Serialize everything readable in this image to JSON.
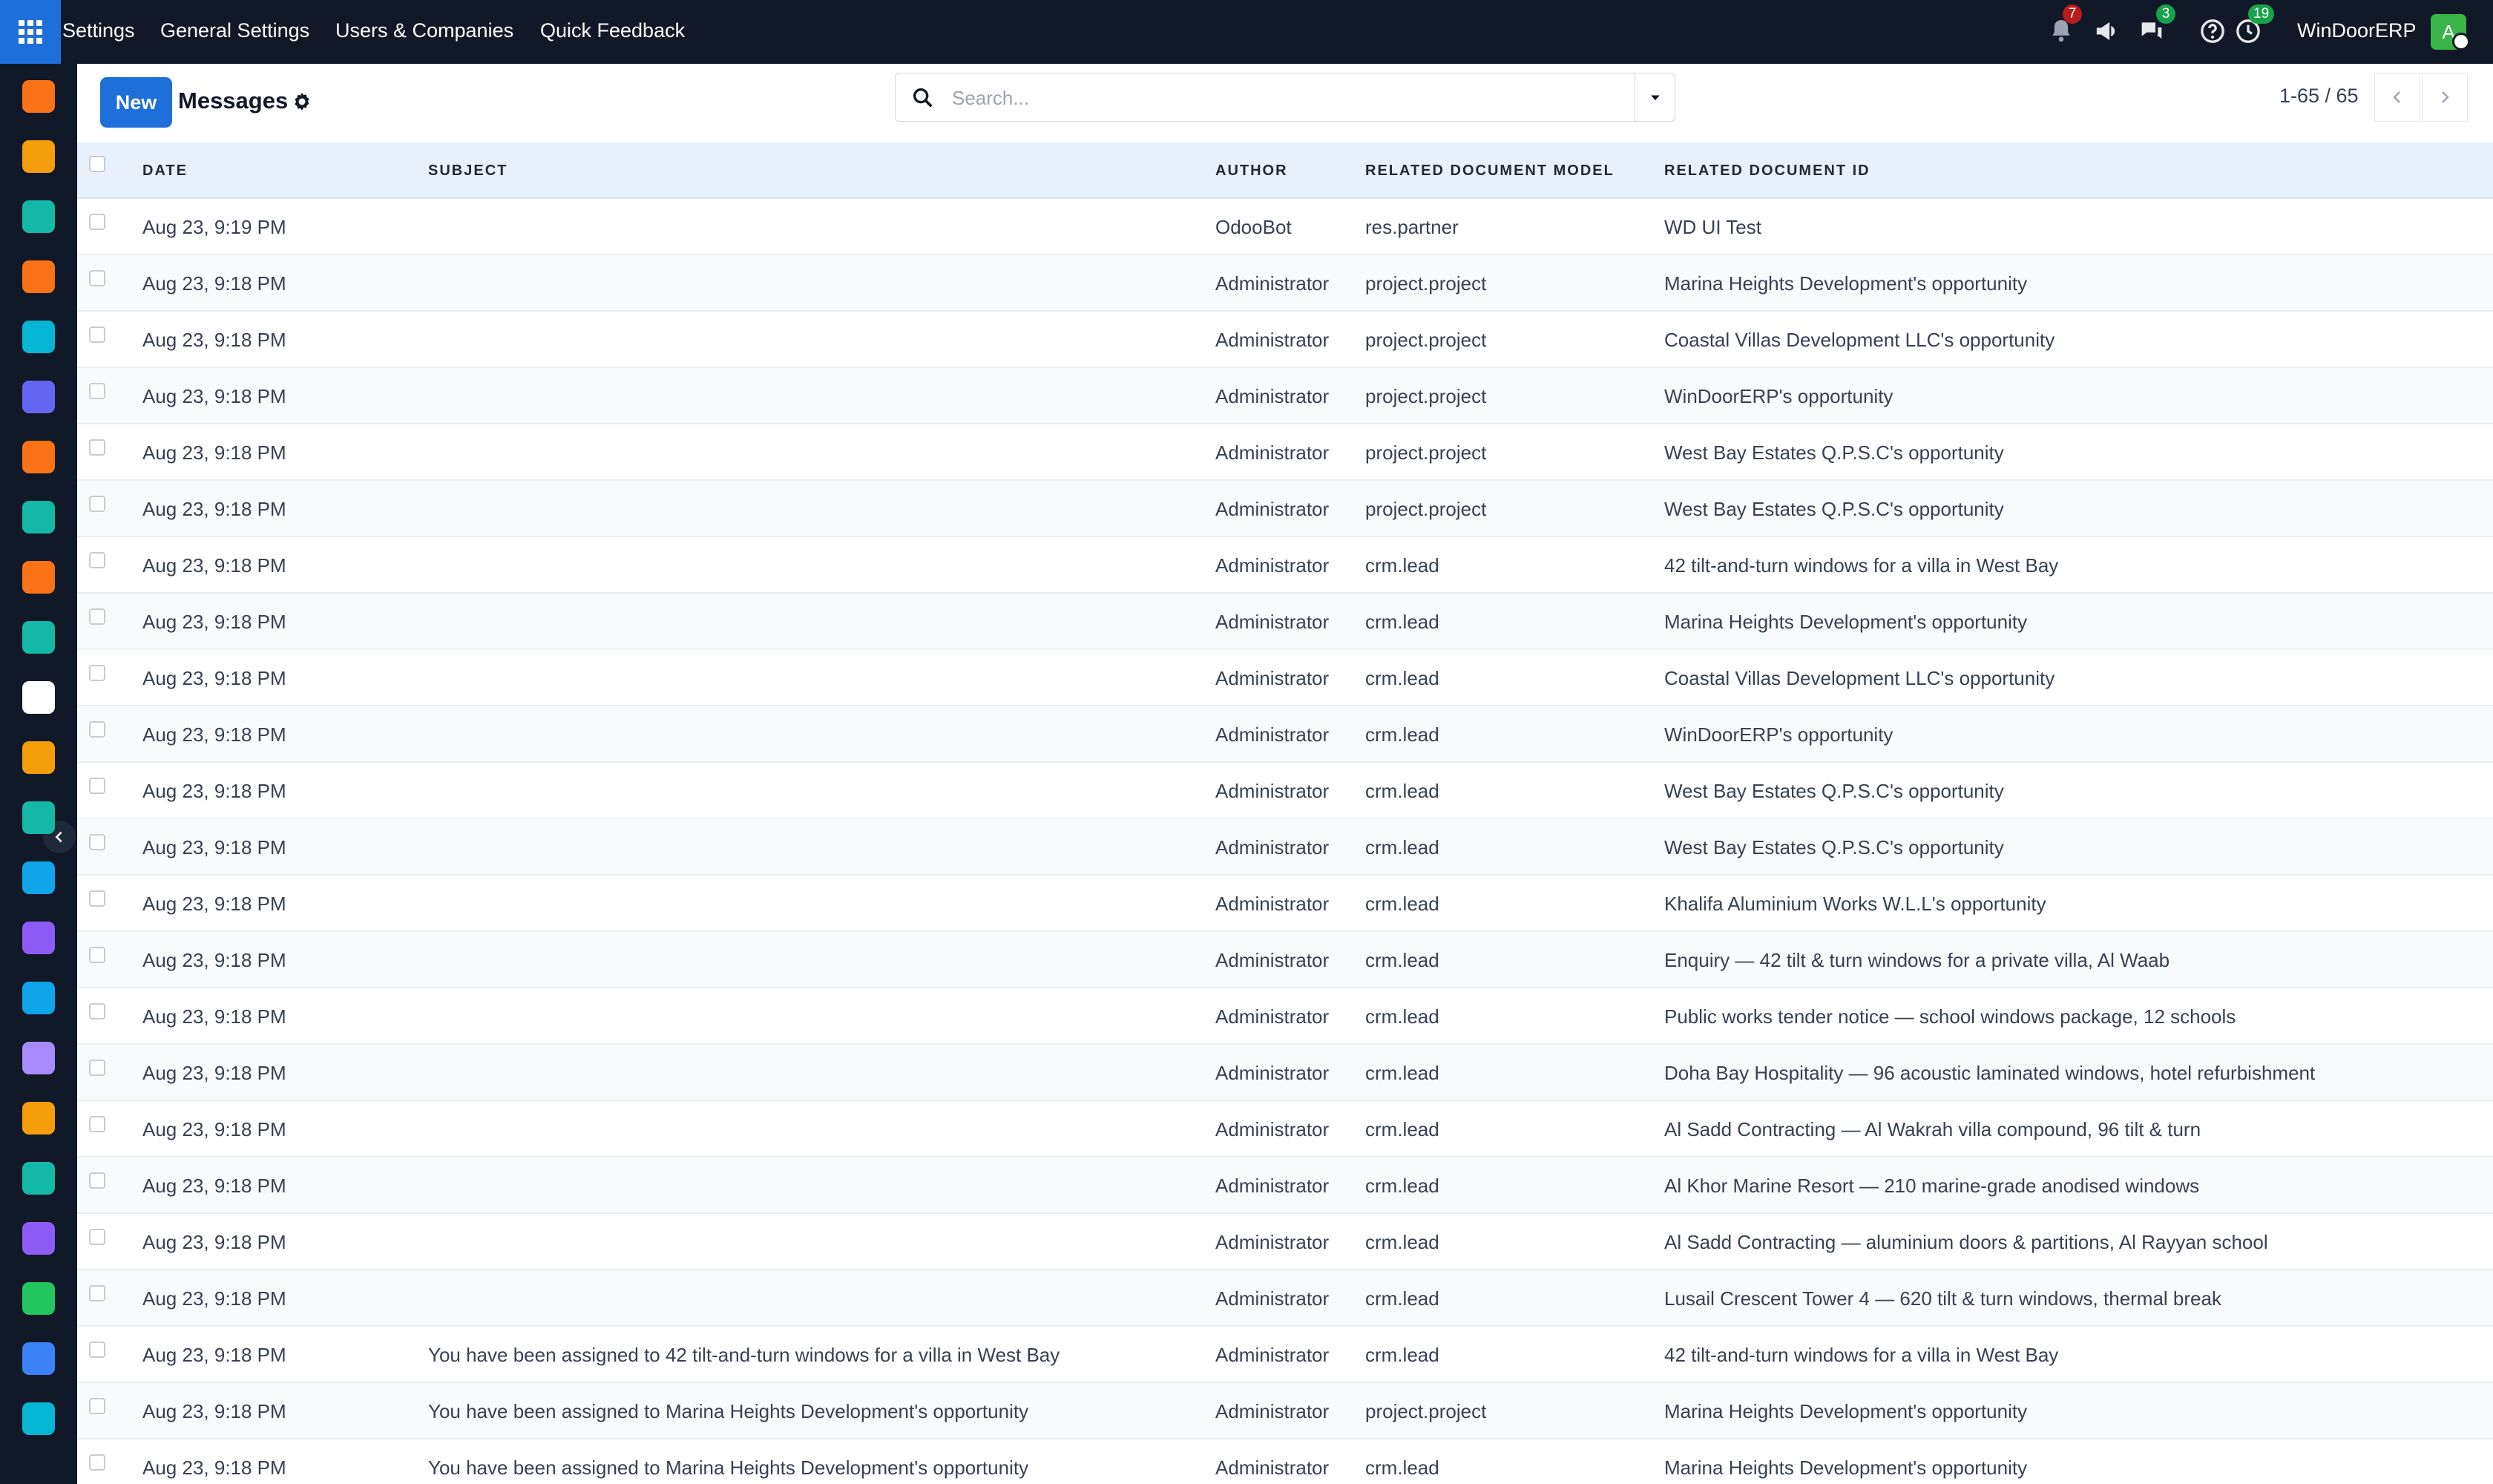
{
  "navbar": {
    "menu": [
      "Settings",
      "General Settings",
      "Users & Companies",
      "Quick Feedback"
    ],
    "notifications_badge": "7",
    "messages_badge": "3",
    "activities_badge": "19",
    "company": "WinDoorERP",
    "avatar_initial": "A"
  },
  "sidebar_apps": [
    {
      "icon": "dashboards-icon",
      "color": "#f97316"
    },
    {
      "icon": "knowledge-icon",
      "color": "#f59e0b"
    },
    {
      "icon": "contacts-icon",
      "color": "#14b8a6"
    },
    {
      "icon": "crm-icon",
      "color": "#f97316"
    },
    {
      "icon": "discuss-icon",
      "color": "#06b6d4"
    },
    {
      "icon": "mail-icon",
      "color": "#6366f1"
    },
    {
      "icon": "livechat-icon",
      "color": "#f97316"
    },
    {
      "icon": "helpdesk-icon",
      "color": "#14b8a6"
    },
    {
      "icon": "spreadsheet-icon",
      "color": "#f97316"
    },
    {
      "icon": "employees-icon",
      "color": "#14b8a6"
    },
    {
      "icon": "inventory-icon",
      "color": "#ffffff"
    },
    {
      "icon": "notes-icon",
      "color": "#f59e0b"
    },
    {
      "icon": "project-icon",
      "color": "#14b8a6"
    },
    {
      "icon": "elearning-icon",
      "color": "#0ea5e9"
    },
    {
      "icon": "purchase-icon",
      "color": "#8b5cf6"
    },
    {
      "icon": "invoicing-icon",
      "color": "#0ea5e9"
    },
    {
      "icon": "team-icon",
      "color": "#a78bfa"
    },
    {
      "icon": "calendar-icon",
      "color": "#f59e0b"
    },
    {
      "icon": "sign-icon",
      "color": "#14b8a6"
    },
    {
      "icon": "apps-store-icon",
      "color": "#8b5cf6"
    },
    {
      "icon": "whatsapp-icon",
      "color": "#22c55e"
    },
    {
      "icon": "timesheet-icon",
      "color": "#3b82f6"
    },
    {
      "icon": "discuss-wave-icon",
      "color": "#06b6d4"
    }
  ],
  "control": {
    "new_label": "New",
    "title": "Messages",
    "search_placeholder": "Search...",
    "pager_value": "1-65 / 65"
  },
  "list": {
    "columns": [
      "DATE",
      "SUBJECT",
      "AUTHOR",
      "RELATED DOCUMENT MODEL",
      "RELATED DOCUMENT ID"
    ],
    "rows": [
      {
        "date": "Aug 23, 9:19 PM",
        "subject": "",
        "author": "OdooBot",
        "model": "res.partner",
        "record": "WD UI Test"
      },
      {
        "date": "Aug 23, 9:18 PM",
        "subject": "",
        "author": "Administrator",
        "model": "project.project",
        "record": "Marina Heights Development's opportunity"
      },
      {
        "date": "Aug 23, 9:18 PM",
        "subject": "",
        "author": "Administrator",
        "model": "project.project",
        "record": "Coastal Villas Development LLC's opportunity"
      },
      {
        "date": "Aug 23, 9:18 PM",
        "subject": "",
        "author": "Administrator",
        "model": "project.project",
        "record": "WinDoorERP's opportunity"
      },
      {
        "date": "Aug 23, 9:18 PM",
        "subject": "",
        "author": "Administrator",
        "model": "project.project",
        "record": "West Bay Estates Q.P.S.C's opportunity"
      },
      {
        "date": "Aug 23, 9:18 PM",
        "subject": "",
        "author": "Administrator",
        "model": "project.project",
        "record": "West Bay Estates Q.P.S.C's opportunity"
      },
      {
        "date": "Aug 23, 9:18 PM",
        "subject": "",
        "author": "Administrator",
        "model": "crm.lead",
        "record": "42 tilt-and-turn windows for a villa in West Bay"
      },
      {
        "date": "Aug 23, 9:18 PM",
        "subject": "",
        "author": "Administrator",
        "model": "crm.lead",
        "record": "Marina Heights Development's opportunity"
      },
      {
        "date": "Aug 23, 9:18 PM",
        "subject": "",
        "author": "Administrator",
        "model": "crm.lead",
        "record": "Coastal Villas Development LLC's opportunity"
      },
      {
        "date": "Aug 23, 9:18 PM",
        "subject": "",
        "author": "Administrator",
        "model": "crm.lead",
        "record": "WinDoorERP's opportunity"
      },
      {
        "date": "Aug 23, 9:18 PM",
        "subject": "",
        "author": "Administrator",
        "model": "crm.lead",
        "record": "West Bay Estates Q.P.S.C's opportunity"
      },
      {
        "date": "Aug 23, 9:18 PM",
        "subject": "",
        "author": "Administrator",
        "model": "crm.lead",
        "record": "West Bay Estates Q.P.S.C's opportunity"
      },
      {
        "date": "Aug 23, 9:18 PM",
        "subject": "",
        "author": "Administrator",
        "model": "crm.lead",
        "record": "Khalifa Aluminium Works W.L.L's opportunity"
      },
      {
        "date": "Aug 23, 9:18 PM",
        "subject": "",
        "author": "Administrator",
        "model": "crm.lead",
        "record": "Enquiry — 42 tilt & turn windows for a private villa, Al Waab"
      },
      {
        "date": "Aug 23, 9:18 PM",
        "subject": "",
        "author": "Administrator",
        "model": "crm.lead",
        "record": "Public works tender notice — school windows package, 12 schools"
      },
      {
        "date": "Aug 23, 9:18 PM",
        "subject": "",
        "author": "Administrator",
        "model": "crm.lead",
        "record": "Doha Bay Hospitality — 96 acoustic laminated windows, hotel refurbishment"
      },
      {
        "date": "Aug 23, 9:18 PM",
        "subject": "",
        "author": "Administrator",
        "model": "crm.lead",
        "record": "Al Sadd Contracting — Al Wakrah villa compound, 96 tilt & turn"
      },
      {
        "date": "Aug 23, 9:18 PM",
        "subject": "",
        "author": "Administrator",
        "model": "crm.lead",
        "record": "Al Khor Marine Resort — 210 marine-grade anodised windows"
      },
      {
        "date": "Aug 23, 9:18 PM",
        "subject": "",
        "author": "Administrator",
        "model": "crm.lead",
        "record": "Al Sadd Contracting — aluminium doors & partitions, Al Rayyan school"
      },
      {
        "date": "Aug 23, 9:18 PM",
        "subject": "",
        "author": "Administrator",
        "model": "crm.lead",
        "record": "Lusail Crescent Tower 4 — 620 tilt & turn windows, thermal break"
      },
      {
        "date": "Aug 23, 9:18 PM",
        "subject": "You have been assigned to 42 tilt-and-turn windows for a villa in West Bay",
        "author": "Administrator",
        "model": "crm.lead",
        "record": "42 tilt-and-turn windows for a villa in West Bay"
      },
      {
        "date": "Aug 23, 9:18 PM",
        "subject": "You have been assigned to Marina Heights Development's opportunity",
        "author": "Administrator",
        "model": "project.project",
        "record": "Marina Heights Development's opportunity"
      },
      {
        "date": "Aug 23, 9:18 PM",
        "subject": "You have been assigned to Marina Heights Development's opportunity",
        "author": "Administrator",
        "model": "crm.lead",
        "record": "Marina Heights Development's opportunity"
      }
    ]
  }
}
